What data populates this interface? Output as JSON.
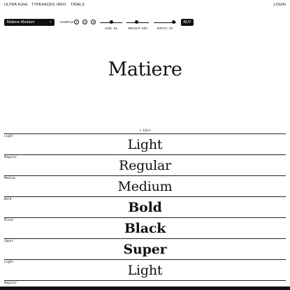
{
  "nav": {
    "links": [
      "ULTRA KUHL",
      "TYPEFACES",
      "INFO",
      "TRIALS"
    ],
    "login": "LOGIN"
  },
  "toolbar": {
    "font_select": "Matiere Medium",
    "sample_label": "SAMPLE",
    "samples": [
      "1",
      "2",
      "3"
    ],
    "size_label": "SIZE: 84",
    "weight_label": "WEIGHT: 500",
    "width_label": "WIDTH: 50",
    "size_value_fraction": 0.5,
    "weight_value_fraction": 0.45,
    "width_value_fraction": 0.98,
    "buy": "BUY"
  },
  "hero": {
    "text": "Matiere"
  },
  "edit": {
    "label": "✎ Edit"
  },
  "weights": [
    {
      "tag": "Light",
      "sample": "Light"
    },
    {
      "tag": "Regular",
      "sample": "Regular"
    },
    {
      "tag": "Medium",
      "sample": "Medium"
    },
    {
      "tag": "Bold",
      "sample": "Bold"
    },
    {
      "tag": "Black",
      "sample": "Black"
    },
    {
      "tag": "Super",
      "sample": "Super"
    },
    {
      "tag": "Light",
      "sample": "Light"
    },
    {
      "tag": "Regular",
      "sample": ""
    }
  ],
  "colors": {
    "ink": "#111111",
    "background": "#ffffff"
  },
  "icons": {
    "select_chevron": "chevron-down-icon",
    "edit": "pencil-icon"
  }
}
